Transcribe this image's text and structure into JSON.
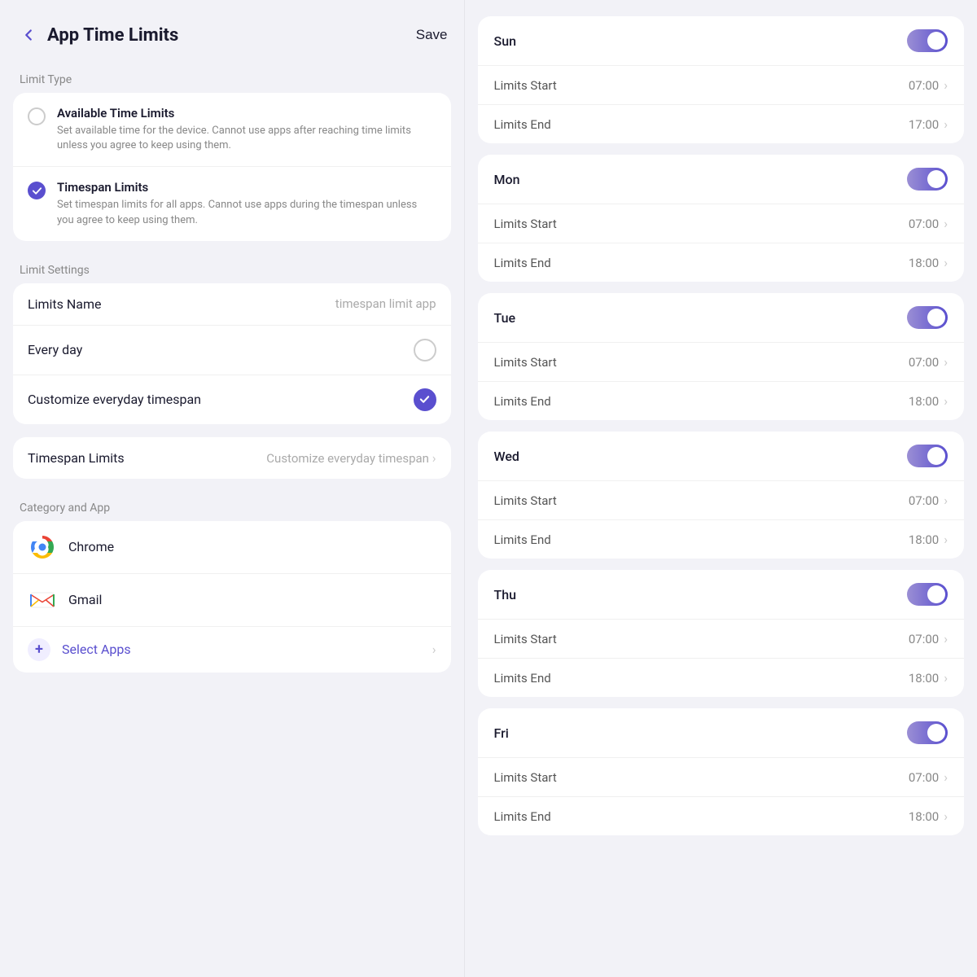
{
  "header": {
    "title": "App Time Limits",
    "save_label": "Save"
  },
  "limit_type_section": {
    "label": "Limit Type",
    "options": [
      {
        "id": "available",
        "checked": false,
        "title": "Available Time Limits",
        "description": "Set available time for the device. Cannot use apps after reaching time limits unless you agree to keep using them."
      },
      {
        "id": "timespan",
        "checked": true,
        "title": "Timespan Limits",
        "description": "Set timespan limits for all apps. Cannot use apps during the timespan unless you agree to keep using them."
      }
    ]
  },
  "limit_settings_section": {
    "label": "Limit Settings",
    "limits_name_label": "Limits Name",
    "limits_name_value": "timespan limit app",
    "every_day_label": "Every day",
    "every_day_checked": false,
    "customize_label": "Customize everyday timespan",
    "customize_checked": true,
    "timespan_label": "Timespan Limits",
    "timespan_value": "Customize everyday timespan",
    "chevron": "›"
  },
  "category_section": {
    "label": "Category and App",
    "apps": [
      {
        "name": "Chrome",
        "icon": "chrome"
      },
      {
        "name": "Gmail",
        "icon": "gmail"
      }
    ],
    "select_apps_label": "Select Apps",
    "chevron": "›"
  },
  "days": [
    {
      "name": "Sun",
      "enabled": true,
      "limits_start_label": "Limits Start",
      "limits_start_value": "07:00",
      "limits_end_label": "Limits End",
      "limits_end_value": "17:00"
    },
    {
      "name": "Mon",
      "enabled": true,
      "limits_start_label": "Limits Start",
      "limits_start_value": "07:00",
      "limits_end_label": "Limits End",
      "limits_end_value": "18:00"
    },
    {
      "name": "Tue",
      "enabled": true,
      "limits_start_label": "Limits Start",
      "limits_start_value": "07:00",
      "limits_end_label": "Limits End",
      "limits_end_value": "18:00"
    },
    {
      "name": "Wed",
      "enabled": true,
      "limits_start_label": "Limits Start",
      "limits_start_value": "07:00",
      "limits_end_label": "Limits End",
      "limits_end_value": "18:00"
    },
    {
      "name": "Thu",
      "enabled": true,
      "limits_start_label": "Limits Start",
      "limits_start_value": "07:00",
      "limits_end_label": "Limits End",
      "limits_end_value": "18:00"
    },
    {
      "name": "Fri",
      "enabled": true,
      "limits_start_label": "Limits Start",
      "limits_start_value": "07:00",
      "limits_end_label": "Limits End",
      "limits_end_value": "18:00"
    }
  ],
  "icons": {
    "chevron": "›",
    "plus": "+"
  }
}
